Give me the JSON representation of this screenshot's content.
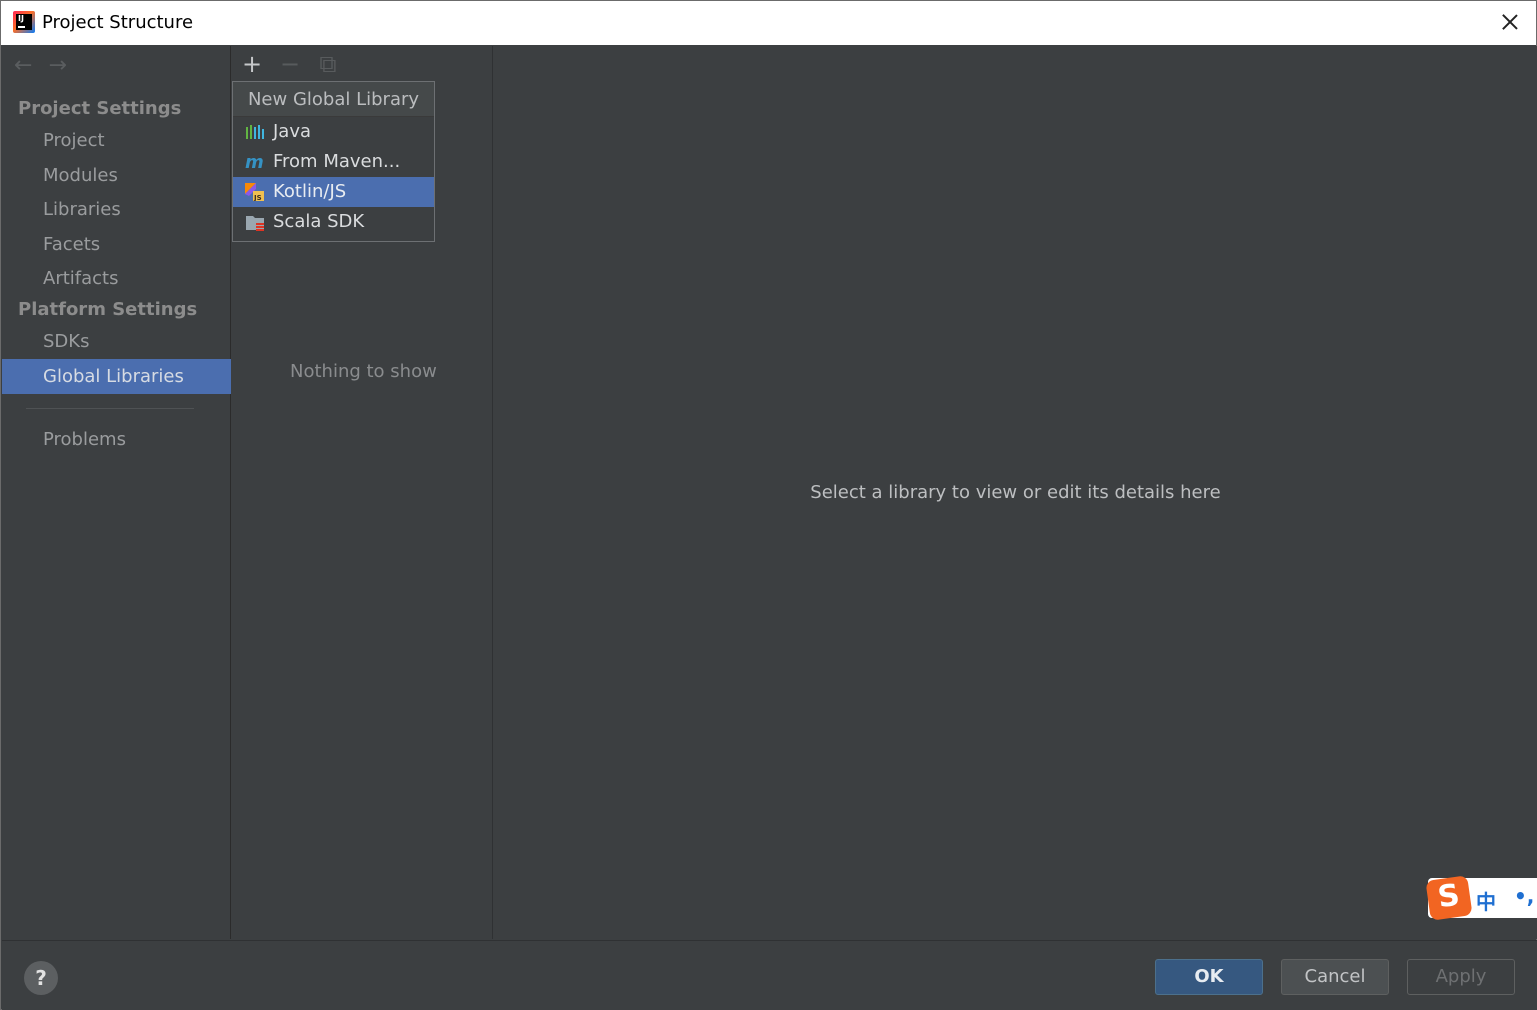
{
  "window": {
    "title": "Project Structure"
  },
  "sidebar": {
    "back_icon": "←",
    "forward_icon": "→",
    "project_settings_header": "Project Settings",
    "project_items": [
      "Project",
      "Modules",
      "Libraries",
      "Facets",
      "Artifacts"
    ],
    "platform_settings_header": "Platform Settings",
    "platform_items": [
      "SDKs",
      "Global Libraries"
    ],
    "selected_item": "Global Libraries",
    "problems_label": "Problems"
  },
  "middle": {
    "toolbar": {
      "add": "+",
      "remove": "−",
      "copy": "⧉"
    },
    "empty_text": "Nothing to show"
  },
  "popup": {
    "title": "New Global Library",
    "items": [
      {
        "label": "Java",
        "icon": "java-library-icon"
      },
      {
        "label": "From Maven...",
        "icon": "maven-icon"
      },
      {
        "label": "Kotlin/JS",
        "icon": "kotlin-js-icon",
        "selected": true
      },
      {
        "label": "Scala SDK",
        "icon": "scala-sdk-icon"
      }
    ]
  },
  "detail": {
    "placeholder": "Select a library to view or edit its details here"
  },
  "footer": {
    "help": "?",
    "ok": "OK",
    "cancel": "Cancel",
    "apply": "Apply"
  },
  "ime": {
    "logo": "S",
    "mode": "中",
    "punct": "•,"
  },
  "colors": {
    "selection": "#4b6eaf",
    "background": "#3c3f41",
    "ok_button": "#365880"
  }
}
